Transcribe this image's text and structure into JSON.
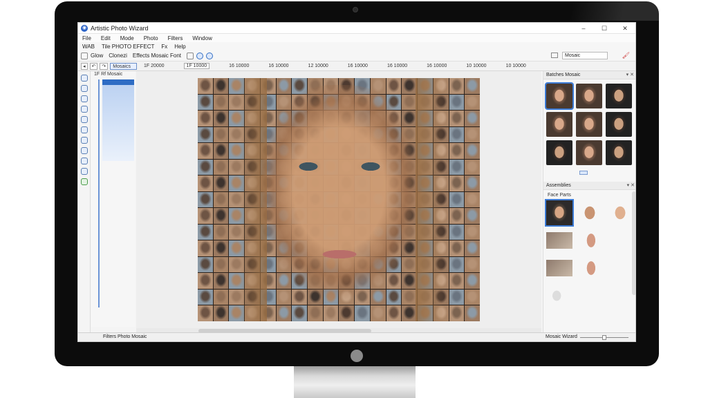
{
  "window": {
    "title": "Artistic Photo Wizard",
    "min": "–",
    "max": "☐",
    "close": "✕"
  },
  "menu": [
    "File",
    "Edit",
    "Mode",
    "Photo",
    "Filters",
    "Window"
  ],
  "toolbar1": [
    "WAB",
    "Tile PHOTO EFFECT",
    "Fx",
    "Help"
  ],
  "toolbar2": {
    "items": [
      "Glow",
      "Clonezi",
      "Effects Mosaic Font"
    ],
    "search_value": "Mosaic",
    "right_glyph": "🖌"
  },
  "ruler": {
    "dropdown": "Mosaics",
    "ticks": [
      "1F 20000",
      "1F 10000",
      "16 10000",
      "16 10000",
      "12 10000",
      "16 10000",
      "16 10000",
      "16 10000",
      "10 10000",
      "10 10000"
    ]
  },
  "layers": {
    "header": "1F  Rf Mosaic"
  },
  "right_panel": {
    "title": "Batches Mosaic",
    "controls": "▾ ✕"
  },
  "assets_panel": {
    "title": "Assemblies",
    "controls": "▾ ✕",
    "sub": "Face Parts"
  },
  "status": {
    "left": "Filters Photo Mosaic",
    "right": "Mosaic Wizard"
  }
}
